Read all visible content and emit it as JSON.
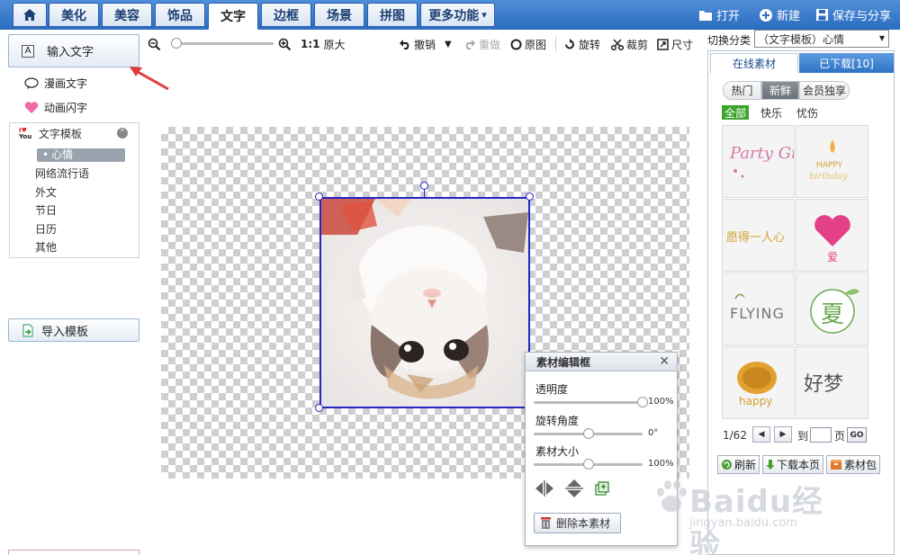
{
  "nav": {
    "home_icon": "home-icon",
    "tabs": [
      {
        "label": "美化"
      },
      {
        "label": "美容"
      },
      {
        "label": "饰品"
      },
      {
        "label": "文字"
      },
      {
        "label": "边框"
      },
      {
        "label": "场景"
      },
      {
        "label": "拼图"
      },
      {
        "label": "更多功能"
      }
    ],
    "active_tab": "文字",
    "right": {
      "open": "打开",
      "new": "新建",
      "save_share": "保存与分享"
    }
  },
  "left_panel": {
    "input_text": "输入文字",
    "comic_text": "漫画文字",
    "anim_text": "动画闪字",
    "template_header": "文字模板",
    "template_items": [
      {
        "label": "心情"
      },
      {
        "label": "网络流行语"
      },
      {
        "label": "外文"
      },
      {
        "label": "节日"
      },
      {
        "label": "日历"
      },
      {
        "label": "其他"
      }
    ],
    "selected_item": "心情",
    "import_template": "导入模板"
  },
  "toolbar": {
    "zoom_value": 0.05,
    "original_size": "原大",
    "ratio": "1:1",
    "undo": "撤销",
    "redo": "重做",
    "original": "原图",
    "rotate": "旋转",
    "crop": "裁剪",
    "size": "尺寸"
  },
  "edit_panel": {
    "title": "素材编辑框",
    "opacity_label": "透明度",
    "opacity_value": "100%",
    "opacity_fraction": 1.0,
    "rotate_label": "旋转角度",
    "rotate_value": "0°",
    "rotate_fraction": 0.5,
    "size_label": "素材大小",
    "size_value": "100%",
    "size_fraction": 0.5,
    "delete_label": "删除本素材"
  },
  "right_panel": {
    "switch_label": "切换分类",
    "category": "（文字模板）心情",
    "tab_online": "在线素材",
    "tab_downloaded": "已下载[10]",
    "seg": [
      {
        "label": "热门"
      },
      {
        "label": "新鲜"
      },
      {
        "label": "会员独享"
      }
    ],
    "seg_selected": "新鲜",
    "filters": [
      {
        "label": "全部"
      },
      {
        "label": "快乐"
      },
      {
        "label": "忧伤"
      }
    ],
    "filter_selected": "全部",
    "materials": [
      {
        "text": "Party Girl",
        "color": "#d77aa7"
      },
      {
        "text": "HAPPY birthday",
        "color": "#d7a23a"
      },
      {
        "text": "愿得一人心",
        "color": "#d2a332"
      },
      {
        "text": "爱",
        "color": "#e4408a"
      },
      {
        "text": "FLYING",
        "color": "#777777"
      },
      {
        "text": "夏",
        "color": "#6aa84f"
      },
      {
        "text": "happy",
        "color": "#d59e2c"
      },
      {
        "text": "好梦",
        "color": "#555555"
      }
    ],
    "page_info": "1/62",
    "goto_label": "到",
    "page_label": "页",
    "go_label": "GO",
    "refresh": "刷新",
    "download_page": "下载本页",
    "material_pack": "素材包"
  },
  "watermark": {
    "main": "Baidu经验",
    "sub": "jingyan.baidu.com"
  },
  "colors": {
    "nav_blue": "#2c6cc0",
    "selection_blue": "#2424c8",
    "filter_green": "#3ca52e",
    "arrow_red": "#e23b3b"
  }
}
